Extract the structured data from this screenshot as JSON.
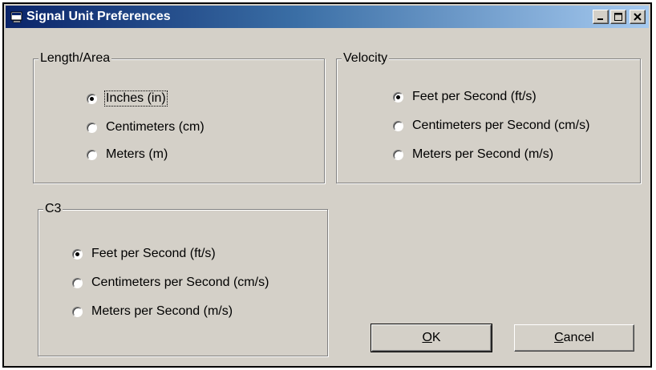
{
  "window": {
    "title": "Signal Unit Preferences",
    "controls": [
      "minimize-icon",
      "maximize-icon",
      "close-icon"
    ]
  },
  "length_group": {
    "label": "Length/Area",
    "options": [
      {
        "label": "Inches (in)",
        "selected": true
      },
      {
        "label": "Centimeters (cm)",
        "selected": false
      },
      {
        "label": "Meters (m)",
        "selected": false
      }
    ]
  },
  "velocity_group": {
    "label": "Velocity",
    "options": [
      {
        "label": "Feet per Second (ft/s)",
        "selected": true
      },
      {
        "label": "Centimeters per Second (cm/s)",
        "selected": false
      },
      {
        "label": "Meters per Second (m/s)",
        "selected": false
      }
    ]
  },
  "c3_group": {
    "label": "C3",
    "options": [
      {
        "label": "Feet per Second (ft/s)",
        "selected": true
      },
      {
        "label": "Centimeters per Second (cm/s)",
        "selected": false
      },
      {
        "label": "Meters per Second (m/s)",
        "selected": false
      }
    ]
  },
  "buttons": {
    "ok_access": "O",
    "ok_rest": "K",
    "cancel_access": "C",
    "cancel_rest": "ancel"
  },
  "colors": {
    "title_start": "#0a246a",
    "title_end": "#a6caf0",
    "face": "#d4d0c8"
  }
}
